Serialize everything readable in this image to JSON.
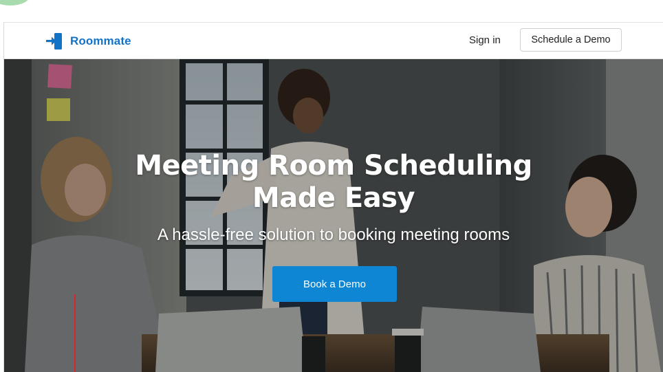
{
  "brand": {
    "name": "Roommate",
    "logo_icon": "door-enter-icon",
    "accent": "#1273c7"
  },
  "nav": {
    "signin_label": "Sign in",
    "schedule_demo_label": "Schedule a Demo"
  },
  "hero": {
    "headline_line1": "Meeting Room Scheduling",
    "headline_line2": "Made Easy",
    "subheadline": "A hassle-free solution to booking meeting rooms",
    "cta_label": "Book a Demo",
    "cta_color": "#0e86d4"
  }
}
